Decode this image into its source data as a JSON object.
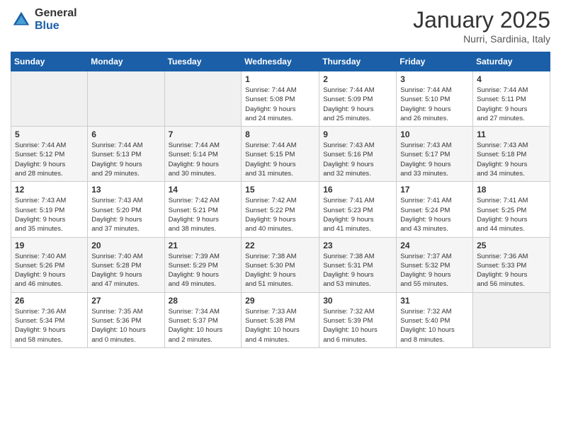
{
  "header": {
    "logo_general": "General",
    "logo_blue": "Blue",
    "month_title": "January 2025",
    "location": "Nurri, Sardinia, Italy"
  },
  "weekdays": [
    "Sunday",
    "Monday",
    "Tuesday",
    "Wednesday",
    "Thursday",
    "Friday",
    "Saturday"
  ],
  "weeks": [
    [
      {
        "day": "",
        "info": ""
      },
      {
        "day": "",
        "info": ""
      },
      {
        "day": "",
        "info": ""
      },
      {
        "day": "1",
        "info": "Sunrise: 7:44 AM\nSunset: 5:08 PM\nDaylight: 9 hours\nand 24 minutes."
      },
      {
        "day": "2",
        "info": "Sunrise: 7:44 AM\nSunset: 5:09 PM\nDaylight: 9 hours\nand 25 minutes."
      },
      {
        "day": "3",
        "info": "Sunrise: 7:44 AM\nSunset: 5:10 PM\nDaylight: 9 hours\nand 26 minutes."
      },
      {
        "day": "4",
        "info": "Sunrise: 7:44 AM\nSunset: 5:11 PM\nDaylight: 9 hours\nand 27 minutes."
      }
    ],
    [
      {
        "day": "5",
        "info": "Sunrise: 7:44 AM\nSunset: 5:12 PM\nDaylight: 9 hours\nand 28 minutes."
      },
      {
        "day": "6",
        "info": "Sunrise: 7:44 AM\nSunset: 5:13 PM\nDaylight: 9 hours\nand 29 minutes."
      },
      {
        "day": "7",
        "info": "Sunrise: 7:44 AM\nSunset: 5:14 PM\nDaylight: 9 hours\nand 30 minutes."
      },
      {
        "day": "8",
        "info": "Sunrise: 7:44 AM\nSunset: 5:15 PM\nDaylight: 9 hours\nand 31 minutes."
      },
      {
        "day": "9",
        "info": "Sunrise: 7:43 AM\nSunset: 5:16 PM\nDaylight: 9 hours\nand 32 minutes."
      },
      {
        "day": "10",
        "info": "Sunrise: 7:43 AM\nSunset: 5:17 PM\nDaylight: 9 hours\nand 33 minutes."
      },
      {
        "day": "11",
        "info": "Sunrise: 7:43 AM\nSunset: 5:18 PM\nDaylight: 9 hours\nand 34 minutes."
      }
    ],
    [
      {
        "day": "12",
        "info": "Sunrise: 7:43 AM\nSunset: 5:19 PM\nDaylight: 9 hours\nand 35 minutes."
      },
      {
        "day": "13",
        "info": "Sunrise: 7:43 AM\nSunset: 5:20 PM\nDaylight: 9 hours\nand 37 minutes."
      },
      {
        "day": "14",
        "info": "Sunrise: 7:42 AM\nSunset: 5:21 PM\nDaylight: 9 hours\nand 38 minutes."
      },
      {
        "day": "15",
        "info": "Sunrise: 7:42 AM\nSunset: 5:22 PM\nDaylight: 9 hours\nand 40 minutes."
      },
      {
        "day": "16",
        "info": "Sunrise: 7:41 AM\nSunset: 5:23 PM\nDaylight: 9 hours\nand 41 minutes."
      },
      {
        "day": "17",
        "info": "Sunrise: 7:41 AM\nSunset: 5:24 PM\nDaylight: 9 hours\nand 43 minutes."
      },
      {
        "day": "18",
        "info": "Sunrise: 7:41 AM\nSunset: 5:25 PM\nDaylight: 9 hours\nand 44 minutes."
      }
    ],
    [
      {
        "day": "19",
        "info": "Sunrise: 7:40 AM\nSunset: 5:26 PM\nDaylight: 9 hours\nand 46 minutes."
      },
      {
        "day": "20",
        "info": "Sunrise: 7:40 AM\nSunset: 5:28 PM\nDaylight: 9 hours\nand 47 minutes."
      },
      {
        "day": "21",
        "info": "Sunrise: 7:39 AM\nSunset: 5:29 PM\nDaylight: 9 hours\nand 49 minutes."
      },
      {
        "day": "22",
        "info": "Sunrise: 7:38 AM\nSunset: 5:30 PM\nDaylight: 9 hours\nand 51 minutes."
      },
      {
        "day": "23",
        "info": "Sunrise: 7:38 AM\nSunset: 5:31 PM\nDaylight: 9 hours\nand 53 minutes."
      },
      {
        "day": "24",
        "info": "Sunrise: 7:37 AM\nSunset: 5:32 PM\nDaylight: 9 hours\nand 55 minutes."
      },
      {
        "day": "25",
        "info": "Sunrise: 7:36 AM\nSunset: 5:33 PM\nDaylight: 9 hours\nand 56 minutes."
      }
    ],
    [
      {
        "day": "26",
        "info": "Sunrise: 7:36 AM\nSunset: 5:34 PM\nDaylight: 9 hours\nand 58 minutes."
      },
      {
        "day": "27",
        "info": "Sunrise: 7:35 AM\nSunset: 5:36 PM\nDaylight: 10 hours\nand 0 minutes."
      },
      {
        "day": "28",
        "info": "Sunrise: 7:34 AM\nSunset: 5:37 PM\nDaylight: 10 hours\nand 2 minutes."
      },
      {
        "day": "29",
        "info": "Sunrise: 7:33 AM\nSunset: 5:38 PM\nDaylight: 10 hours\nand 4 minutes."
      },
      {
        "day": "30",
        "info": "Sunrise: 7:32 AM\nSunset: 5:39 PM\nDaylight: 10 hours\nand 6 minutes."
      },
      {
        "day": "31",
        "info": "Sunrise: 7:32 AM\nSunset: 5:40 PM\nDaylight: 10 hours\nand 8 minutes."
      },
      {
        "day": "",
        "info": ""
      }
    ]
  ]
}
